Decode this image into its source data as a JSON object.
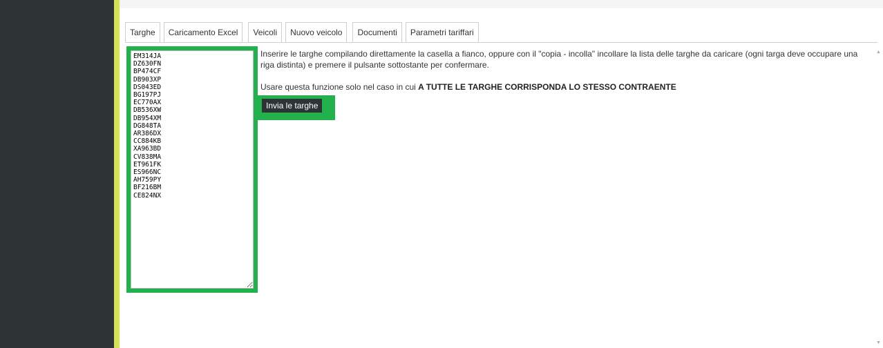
{
  "tabs": [
    {
      "label": "Targhe"
    },
    {
      "label": "Caricamento Excel"
    },
    {
      "label": "Veicoli"
    },
    {
      "label": "Nuovo veicolo"
    },
    {
      "label": "Documenti"
    },
    {
      "label": "Parametri tariffari"
    }
  ],
  "plates_input": {
    "value": "EM314JA\nDZ630FN\nBP474CF\nDB903XP\nDS043ED\nBG197PJ\nEC770AX\nDB536XW\nDB954XM\nDG848TA\nAR386DX\nCC884KB\nXA963BD\nCV838MA\nET961FK\nES966NC\nAH759PY\nBF216BM\nCE824NX\n"
  },
  "instructions": {
    "line1": "Inserire le targhe compilando direttamente la casella a fianco, oppure con il \"copia - incolla\" incollare la lista delle targhe da caricare  (ogni targa deve occupare una riga distinta) e premere il pulsante sottostante per confermare.",
    "line2_prefix": "Usare questa funzione solo nel caso in cui ",
    "line2_bold": "A TUTTE LE TARGHE CORRISPONDA LO STESSO CONTRAENTE"
  },
  "submit_button": {
    "label": "Invia le targhe"
  },
  "colors": {
    "sidebar": "#2e3436",
    "accent": "#d4e157",
    "highlight": "#22b14c",
    "button": "#2e3436"
  },
  "icons": {
    "scroll_up": "▲",
    "scroll_down": "▼"
  }
}
